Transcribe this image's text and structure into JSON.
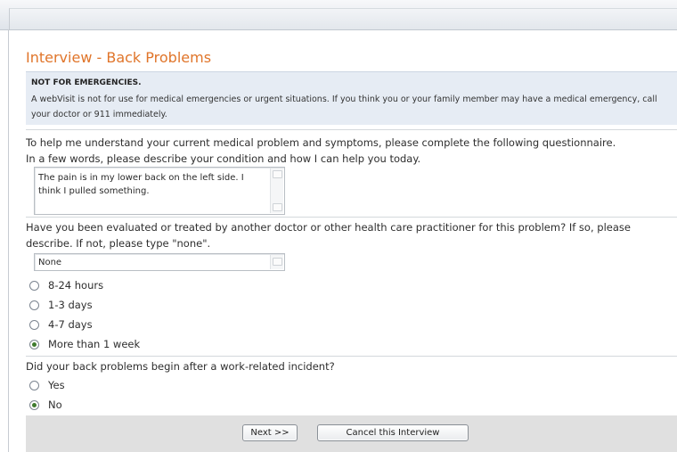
{
  "page": {
    "title": "Interview - Back Problems"
  },
  "notice": {
    "heading": "NOT FOR EMERGENCIES.",
    "text": "A webVisit is not for use for medical emergencies or urgent situations. If you think you or your family member may have a medical emergency, call your doctor or 911 immediately."
  },
  "intro": {
    "line1": "To help me understand your current medical problem and symptoms, please complete the following questionnaire.",
    "line2": "In a few words, please describe your condition and how I can help you today."
  },
  "condition": {
    "value": "The pain is in my lower back on the left side. I think I pulled something."
  },
  "prior_treatment": {
    "question": "Have you been evaluated or treated by another doctor or other health care practitioner for this problem? If so, please describe. If not, please type \"none\".",
    "value": "None"
  },
  "duration": {
    "options": [
      {
        "label": "8-24 hours",
        "checked": false
      },
      {
        "label": "1-3 days",
        "checked": false
      },
      {
        "label": "4-7 days",
        "checked": false
      },
      {
        "label": "More than 1 week",
        "checked": true
      }
    ]
  },
  "work_related": {
    "question": "Did your back problems begin after a work-related incident?",
    "options": [
      {
        "label": "Yes",
        "checked": false
      },
      {
        "label": "No",
        "checked": true
      }
    ]
  },
  "footer": {
    "next_label": "Next >>",
    "cancel_label": "Cancel this Interview"
  },
  "colors": {
    "title": "#e0752a",
    "notice_bg": "#e6ecf4",
    "footer_bg": "#e0e0e0"
  }
}
